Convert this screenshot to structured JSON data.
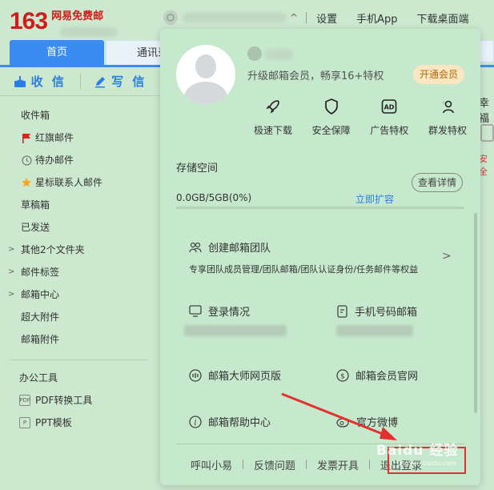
{
  "logo": {
    "number": "163",
    "text": "网易免费邮"
  },
  "tabs": {
    "home": "首页",
    "contacts": "通讯录"
  },
  "actions": {
    "receive": "收 信",
    "compose": "写 信"
  },
  "folders": [
    {
      "label": "收件箱",
      "icon": "inbox"
    },
    {
      "label": "红旗邮件",
      "icon": "red-flag"
    },
    {
      "label": "待办邮件",
      "icon": "clock"
    },
    {
      "label": "星标联系人邮件",
      "icon": "star"
    },
    {
      "label": "草稿箱",
      "icon": ""
    },
    {
      "label": "已发送",
      "icon": ""
    },
    {
      "label": "其他2个文件夹",
      "icon": "",
      "expandable": true
    },
    {
      "label": "邮件标签",
      "icon": "",
      "expandable": true
    },
    {
      "label": "邮箱中心",
      "icon": "",
      "expandable": true
    },
    {
      "label": "超大附件",
      "icon": ""
    },
    {
      "label": "邮箱附件",
      "icon": ""
    }
  ],
  "tools": {
    "title": "办公工具",
    "items": [
      {
        "label": "PDF转换工具",
        "icon": "pdf-icon"
      },
      {
        "label": "PPT模板",
        "icon": "ppt-icon"
      }
    ]
  },
  "topnav": {
    "settings": "设置",
    "mobile_app": "手机App",
    "download": "下载桌面端"
  },
  "right_peek": {
    "text1": "幸福",
    "text2": "安全"
  },
  "popup": {
    "upgrade_text": "升级邮箱会员，畅享16+特权",
    "vip_button": "开通会员",
    "features": [
      {
        "label": "极速下载",
        "icon": "rocket-icon"
      },
      {
        "label": "安全保障",
        "icon": "shield-icon"
      },
      {
        "label": "广告特权",
        "icon": "ad-icon"
      },
      {
        "label": "群发特权",
        "icon": "group-send-icon"
      }
    ],
    "storage": {
      "title": "存储空间",
      "details_button": "查看详情",
      "value": "0.0GB/5GB(0%)",
      "expand_link": "立即扩容",
      "used_fraction": 0
    },
    "team": {
      "title": "创建邮箱团队",
      "description": "专享团队成员管理/团队邮箱/团队认证身份/任务邮件等权益"
    },
    "grid": {
      "login_status": "登录情况",
      "phone_mail": "手机号码邮箱",
      "master_web": "邮箱大师网页版",
      "member_site": "邮箱会员官网",
      "help_center": "邮箱帮助中心",
      "official_weibo": "官方微博"
    },
    "bottom": {
      "assistant": "呼叫小易",
      "feedback": "反馈问题",
      "ticket": "发票开具",
      "logout": "退出登录"
    }
  },
  "watermark": {
    "main": "Baidu 经验",
    "sub": "jingyan.baidu.com"
  },
  "colors": {
    "brand_red": "#d21a1a",
    "accent_blue": "#3b8cf0",
    "highlight_red": "#e23131",
    "vip_orange": "#b06b12"
  }
}
